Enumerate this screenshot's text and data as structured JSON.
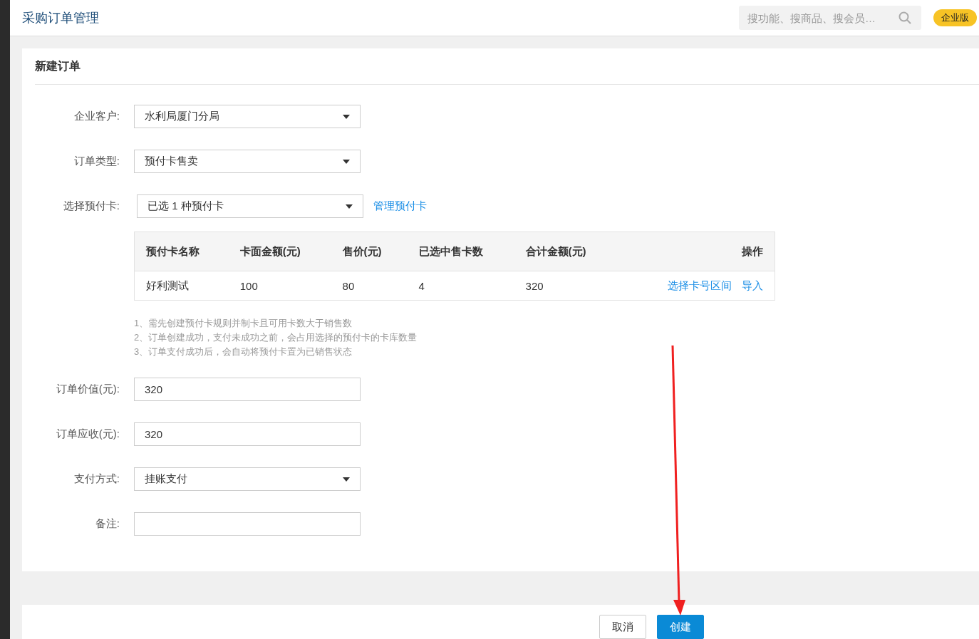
{
  "header": {
    "title": "采购订单管理",
    "search": {
      "placeholder": "搜功能、搜商品、搜会员…"
    },
    "badge": "企业版"
  },
  "form": {
    "title": "新建订单",
    "rows_before": [
      {
        "kind": "select",
        "label": "企业客户:",
        "value": "水利局厦门分局"
      },
      {
        "kind": "select",
        "label": "订单类型:",
        "value": "预付卡售卖"
      },
      {
        "kind": "select",
        "label": "选择预付卡:",
        "value": "已选 1 种预付卡",
        "link": "管理预付卡"
      }
    ],
    "table": {
      "columns": [
        "预付卡名称",
        "卡面金额(元)",
        "售价(元)",
        "已选中售卡数",
        "合计金额(元)",
        "操作"
      ],
      "rows": [
        {
          "cells": [
            "好利测试",
            "100",
            "80",
            "4",
            "320"
          ],
          "actions": [
            "选择卡号区间",
            "导入"
          ]
        }
      ]
    },
    "notes": [
      "1、需先创建预付卡规则并制卡且可用卡数大于销售数",
      "2、订单创建成功，支付未成功之前，会占用选择的预付卡的卡库数量",
      "3、订单支付成功后，会自动将预付卡置为已销售状态"
    ],
    "rows_after": [
      {
        "kind": "input",
        "label": "订单价值(元):",
        "value": "320"
      },
      {
        "kind": "input",
        "label": "订单应收(元):",
        "value": "320"
      },
      {
        "kind": "select",
        "label": "支付方式:",
        "value": "挂账支付"
      },
      {
        "kind": "input",
        "label": "备注:"
      }
    ]
  },
  "footer": {
    "buttons": [
      {
        "label": "取消",
        "kind": "secondary"
      },
      {
        "label": "创建",
        "kind": "primary"
      }
    ]
  }
}
